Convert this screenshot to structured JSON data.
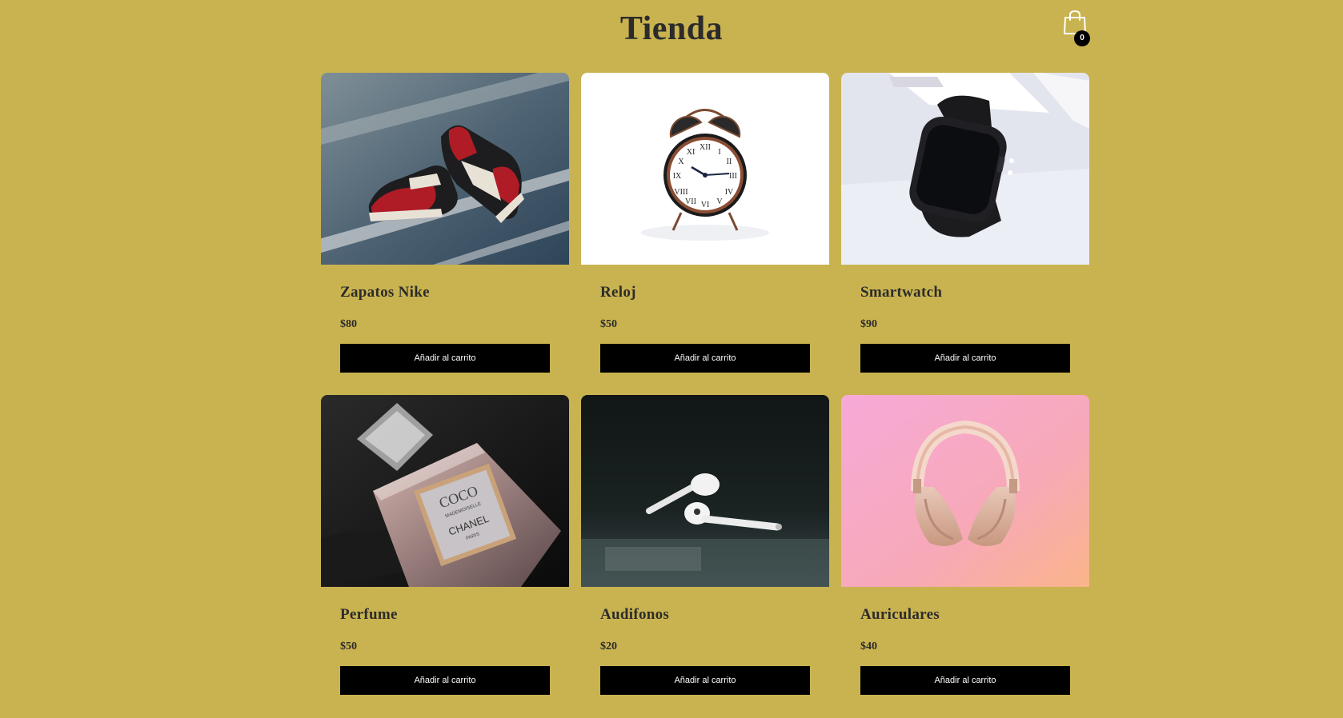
{
  "header": {
    "title": "Tienda",
    "cart_count": "0",
    "cart_icon": "shopping-bag-icon"
  },
  "products": [
    {
      "name": "Zapatos Nike",
      "price": "$80",
      "button": "Añadir al carrito",
      "image": "sneakers-photo"
    },
    {
      "name": "Reloj",
      "price": "$50",
      "button": "Añadir al carrito",
      "image": "alarm-clock-photo"
    },
    {
      "name": "Smartwatch",
      "price": "$90",
      "button": "Añadir al carrito",
      "image": "smartwatch-photo"
    },
    {
      "name": "Perfume",
      "price": "$50",
      "button": "Añadir al carrito",
      "image": "perfume-bottle-photo"
    },
    {
      "name": "Audifonos",
      "price": "$20",
      "button": "Añadir al carrito",
      "image": "earbuds-photo"
    },
    {
      "name": "Auriculares",
      "price": "$40",
      "button": "Añadir al carrito",
      "image": "headphones-photo"
    }
  ],
  "perfume_label": [
    "COCO",
    "MADEMOISELLE",
    "CHANEL",
    "PARIS"
  ],
  "colors": {
    "background": "#c9b350",
    "button": "#000000",
    "button_text": "#ffffff",
    "text": "#2b2b2b"
  }
}
